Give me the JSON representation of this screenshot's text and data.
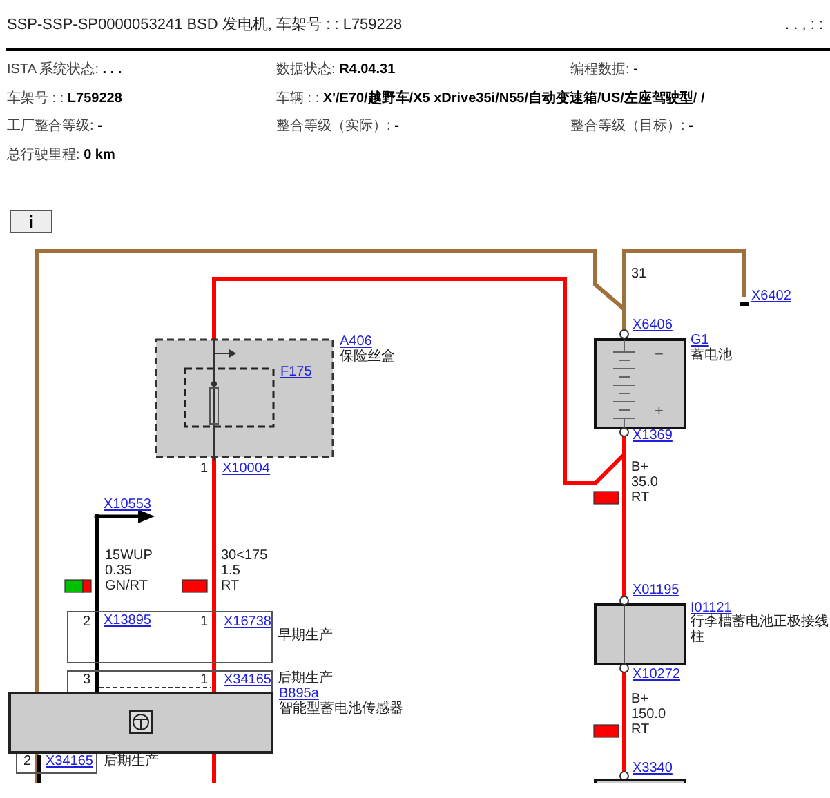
{
  "header": {
    "title": "SSP-SSP-SP0000053241 BSD 发电机, 车架号 : : L759228",
    "corner": ".  .    ,  :  :"
  },
  "info_rows": [
    [
      {
        "label": "ISTA 系统状态:",
        "value": ".  .  ."
      },
      {
        "label": "数据状态:",
        "value": "R4.04.31"
      },
      {
        "label": "编程数据:",
        "value": "-"
      }
    ],
    [
      {
        "label": "车架号 : :",
        "value": "L759228"
      },
      {
        "label": "车辆 : :",
        "value": "X'/E70/越野车/X5 xDrive35i/N55/自动变速箱/US/左座驾驶型/      /"
      }
    ],
    [
      {
        "label": "工厂整合等级:",
        "value": "-"
      },
      {
        "label": "整合等级（实际）:",
        "value": "-"
      },
      {
        "label": "整合等级（目标）:",
        "value": "-"
      }
    ],
    [
      {
        "label": "总行驶里程:",
        "value": "0 km"
      }
    ]
  ],
  "toolbar": {
    "info_button": "i"
  },
  "diagram": {
    "components": [
      {
        "ref": "A406",
        "name": "保险丝盒"
      },
      {
        "ref": "F175"
      },
      {
        "ref": "G1",
        "name": "蓄电池",
        "terminals": [
          "−",
          "+"
        ]
      },
      {
        "ref": "I01121",
        "name": "行李槽蓄电池正极接线柱"
      },
      {
        "ref": "B895a",
        "name": "智能型蓄电池传感器"
      }
    ],
    "connectors": [
      {
        "id": "X6406"
      },
      {
        "id": "X6402"
      },
      {
        "id": "X1369"
      },
      {
        "id": "X10004",
        "pins": [
          "1"
        ]
      },
      {
        "id": "X10553"
      },
      {
        "id": "X13895",
        "pins": [
          "2"
        ]
      },
      {
        "id": "X16738",
        "pins": [
          "1"
        ]
      },
      {
        "id": "X34165",
        "pins": [
          "3",
          "1"
        ]
      },
      {
        "id": "X34165",
        "pins": [
          "2"
        ]
      },
      {
        "id": "X01195"
      },
      {
        "id": "X10272"
      },
      {
        "id": "X3340"
      }
    ],
    "wires": [
      {
        "lines": [
          "31"
        ]
      },
      {
        "lines": [
          "B+",
          "35.0",
          "RT"
        ],
        "swatch": [
          {
            "color": "#ff0000"
          }
        ]
      },
      {
        "lines": [
          "15WUP",
          "0.35",
          "GN/RT"
        ],
        "swatch": [
          {
            "color": "#00c000"
          },
          {
            "color": "#ff0000"
          }
        ]
      },
      {
        "lines": [
          "30<175",
          "1.5",
          "RT"
        ],
        "swatch": [
          {
            "color": "#ff0000"
          }
        ]
      },
      {
        "lines": [
          "B+",
          "150.0",
          "RT"
        ],
        "swatch": [
          {
            "color": "#ff0000"
          }
        ]
      }
    ],
    "notes": [
      "早期生产",
      "后期生产",
      "后期生产"
    ]
  }
}
